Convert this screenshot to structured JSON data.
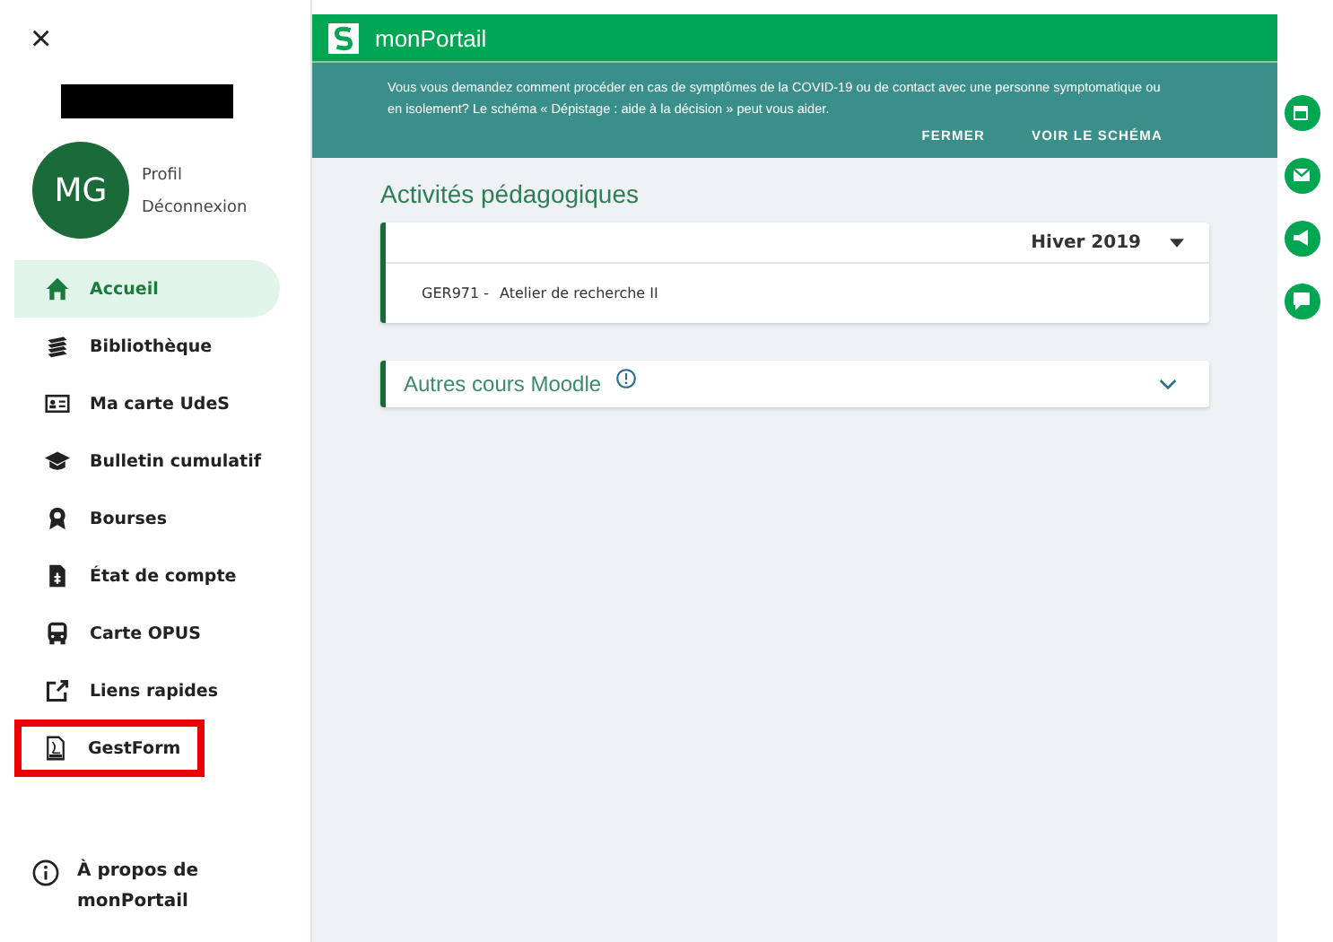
{
  "sidebar": {
    "close": "×",
    "user": {
      "initials": "MG",
      "links": [
        "Profil",
        "Déconnexion"
      ]
    },
    "items": [
      {
        "label": "Accueil",
        "selected": true,
        "highlighted": false
      },
      {
        "label": "Bibliothèque",
        "selected": false,
        "highlighted": false
      },
      {
        "label": "Ma carte UdeS",
        "selected": false,
        "highlighted": false
      },
      {
        "label": "Bulletin cumulatif",
        "selected": false,
        "highlighted": false
      },
      {
        "label": "Bourses",
        "selected": false,
        "highlighted": false
      },
      {
        "label": "État de compte",
        "selected": false,
        "highlighted": false
      },
      {
        "label": "Carte OPUS",
        "selected": false,
        "highlighted": false
      },
      {
        "label": "Liens rapides",
        "selected": false,
        "highlighted": false
      },
      {
        "label": "GestForm",
        "selected": false,
        "highlighted": true
      }
    ],
    "about": "À propos de monPortail"
  },
  "header": {
    "title": "monPortail"
  },
  "banner": {
    "text": "Vous vous demandez comment procéder en cas de symptômes de la COVID-19 ou de contact avec une personne symptomatique ou en isolement? Le schéma « Dépistage : aide à la décision » peut vous aider.",
    "actions": [
      "FERMER",
      "VOIR LE SCHÉMA"
    ]
  },
  "section_title": "Activités pédagogiques",
  "activities": {
    "term": "Hiver 2019",
    "courses": [
      {
        "code": "GER971 -",
        "title": "Atelier de recherche II"
      }
    ]
  },
  "moodle": {
    "title": "Autres cours Moodle",
    "expanded": false
  }
}
